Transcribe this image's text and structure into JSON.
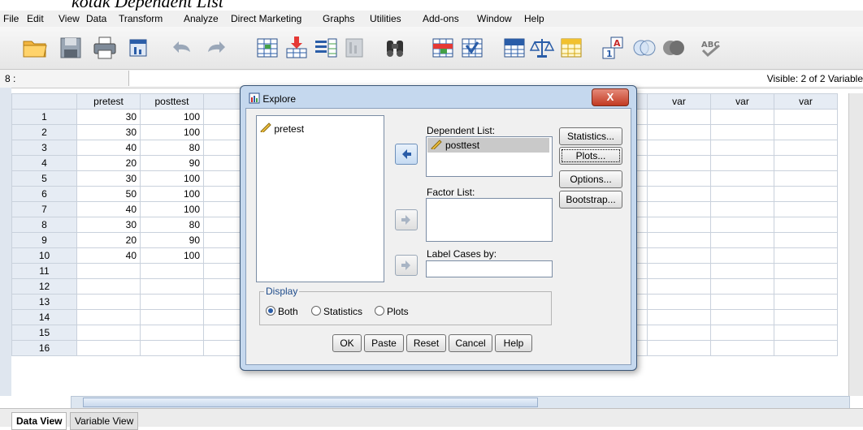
{
  "caption": "kotak Dependent List",
  "menu": [
    "File",
    "Edit",
    "View",
    "Data",
    "Transform",
    "Analyze",
    "Direct Marketing",
    "Graphs",
    "Utilities",
    "Add-ons",
    "Window",
    "Help"
  ],
  "toolbar_icons": [
    "open-folder-icon",
    "save-icon",
    "print-icon",
    "dialog-recall-icon",
    "undo-icon",
    "redo-icon",
    "goto-case-icon",
    "goto-variable-icon",
    "variables-icon",
    "run-descriptives-icon",
    "find-icon",
    "insert-cases-icon",
    "insert-variable-icon",
    "split-file-icon",
    "weight-cases-icon",
    "select-cases-icon",
    "value-labels-icon",
    "use-sets-icon",
    "show-all-variables-icon",
    "spell-check-icon"
  ],
  "cellbar": {
    "ref": "8 :",
    "visible": "Visible: 2 of 2 Variable"
  },
  "grid": {
    "columns": [
      "pretest",
      "posttest",
      "",
      "",
      "",
      "",
      "",
      "",
      "",
      "var",
      "var",
      "var"
    ],
    "rows": [
      {
        "n": "1",
        "pre": "30",
        "post": "100"
      },
      {
        "n": "2",
        "pre": "30",
        "post": "100"
      },
      {
        "n": "3",
        "pre": "40",
        "post": "80"
      },
      {
        "n": "4",
        "pre": "20",
        "post": "90"
      },
      {
        "n": "5",
        "pre": "30",
        "post": "100"
      },
      {
        "n": "6",
        "pre": "50",
        "post": "100"
      },
      {
        "n": "7",
        "pre": "40",
        "post": "100"
      },
      {
        "n": "8",
        "pre": "30",
        "post": "80"
      },
      {
        "n": "9",
        "pre": "20",
        "post": "90"
      },
      {
        "n": "10",
        "pre": "40",
        "post": "100"
      },
      {
        "n": "11",
        "pre": "",
        "post": ""
      },
      {
        "n": "12",
        "pre": "",
        "post": ""
      },
      {
        "n": "13",
        "pre": "",
        "post": ""
      },
      {
        "n": "14",
        "pre": "",
        "post": ""
      },
      {
        "n": "15",
        "pre": "",
        "post": ""
      },
      {
        "n": "16",
        "pre": "",
        "post": ""
      }
    ]
  },
  "tabs": {
    "data_view": "Data View",
    "variable_view": "Variable View"
  },
  "dialog": {
    "title": "Explore",
    "close": "X",
    "source_items": [
      "pretest"
    ],
    "dependent_label": "Dependent List:",
    "dependent_items": [
      "posttest"
    ],
    "factor_label": "Factor List:",
    "label_cases_label": "Label Cases by:",
    "side_buttons": [
      "Statistics...",
      "Plots...",
      "Options...",
      "Bootstrap..."
    ],
    "display": {
      "legend": "Display",
      "both": "Both",
      "statistics": "Statistics",
      "plots": "Plots",
      "selected": "both"
    },
    "bottom_buttons": [
      "OK",
      "Paste",
      "Reset",
      "Cancel",
      "Help"
    ]
  }
}
